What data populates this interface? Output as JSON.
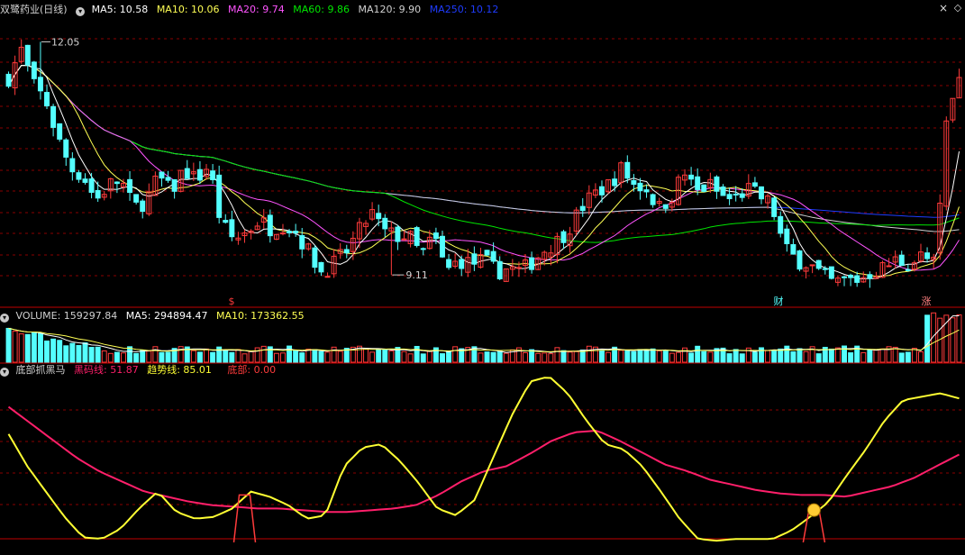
{
  "colors": {
    "up": "#ff3b3b",
    "down": "#54ffff",
    "ma5": "#ffffff",
    "ma10": "#ffff54",
    "ma20": "#ff54ff",
    "ma60": "#00e600",
    "ma120": "#d0d0d0",
    "ma250": "#1f3cff",
    "hei": "#ff1f6a",
    "trend": "#ffff33",
    "grid": "#8a0000",
    "text": "#d0d0d0"
  },
  "main": {
    "stock_name": "双鹭药业(日线)",
    "ma5_label": "MA5: 10.58",
    "ma10_label": "MA10: 10.06",
    "ma20_label": "MA20: 9.74",
    "ma60_label": "MA60: 9.86",
    "ma120_label": "MA120: 9.90",
    "ma250_label": "MA250: 10.12",
    "high_label": "12.05",
    "low_label": "9.11",
    "markers": [
      {
        "text": "$",
        "color": "#ff3b3b"
      },
      {
        "text": "财",
        "color": "#54ffff"
      },
      {
        "text": "涨",
        "color": "#ff8080"
      }
    ]
  },
  "volume": {
    "label": "VOLUME: 159297.84",
    "ma5_label": "MA5: 294894.47",
    "ma10_label": "MA10: 173362.55"
  },
  "indicator": {
    "name": "底部抓黑马",
    "hei_label": "黑码线: 51.87",
    "trend_label": "趋势线: 85.01",
    "bottom_label": "底部: 0.00"
  },
  "corner_icons": {
    "close": "close-icon",
    "diamond": "diamond-icon"
  },
  "chart_data": {
    "type": "candlestick",
    "n": 150,
    "price_range": [
      8.85,
      12.35
    ],
    "close_path": [
      11.6,
      11.95,
      11.5,
      11.3,
      10.8,
      10.45,
      10.35,
      10.05,
      10.25,
      10.3,
      9.95,
      10.05,
      10.35,
      10.15,
      10.45,
      10.3,
      10.5,
      9.75,
      9.55,
      9.65,
      9.8,
      9.7,
      9.75,
      9.65,
      9.4,
      9.15,
      9.25,
      9.4,
      9.65,
      9.9,
      9.65,
      9.6,
      9.6,
      9.35,
      9.6,
      9.15,
      9.3,
      9.25,
      9.3,
      9.15,
      9.2,
      9.15,
      9.3,
      9.45,
      9.55,
      9.75,
      10.0,
      10.15,
      10.25,
      10.45,
      10.25,
      10.2,
      9.95,
      10.1,
      10.4,
      10.15,
      10.25,
      10.1,
      10.05,
      10.2,
      10.1,
      10.0,
      9.45,
      9.3,
      9.25,
      9.1,
      9.0,
      9.05,
      9.05,
      9.15,
      9.2,
      9.3,
      9.25,
      9.35,
      9.25,
      11.0,
      11.6
    ],
    "volume_range": [
      0,
      460000
    ],
    "indicator_range": [
      0,
      100
    ],
    "hei_line": [
      80,
      70,
      60,
      50,
      42,
      36,
      30,
      27,
      24,
      22,
      21,
      20,
      20,
      19,
      18,
      18,
      19,
      20,
      22,
      28,
      36,
      42,
      45,
      52,
      60,
      65,
      66,
      60,
      53,
      46,
      42,
      37,
      34,
      31,
      29,
      28,
      28,
      27,
      30,
      33,
      38,
      45,
      51.87
    ],
    "trend_line": [
      64,
      45,
      30,
      15,
      3,
      2,
      8,
      20,
      30,
      18,
      14,
      15,
      20,
      30,
      27,
      22,
      14,
      16,
      45,
      56,
      58,
      48,
      35,
      20,
      16,
      25,
      50,
      75,
      95,
      98,
      88,
      72,
      58,
      55,
      45,
      30,
      14,
      2,
      1,
      2,
      2,
      2,
      7,
      15,
      24,
      40,
      55,
      72,
      84,
      86,
      88,
      85.01
    ],
    "bottom_spikes": [
      {
        "at": 0.25,
        "value": 28
      },
      {
        "at": 0.845,
        "value": 18
      }
    ]
  }
}
